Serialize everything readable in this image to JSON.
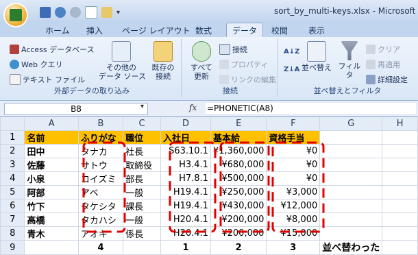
{
  "window": {
    "title": "sort_by_multi-keys.xlsx - Microsoft Exce"
  },
  "tabs": [
    "ホーム",
    "挿入",
    "ページ レイアウト",
    "数式",
    "データ",
    "校閲",
    "表示"
  ],
  "ribbon": {
    "external": {
      "access": "Access データベース",
      "web": "Web クエリ",
      "text": "テキスト ファイル",
      "other": "その他の\nデータ ソース",
      "existing": "既存の\n接続",
      "label": "外部データの取り込み"
    },
    "connections": {
      "refresh": "すべて\n更新",
      "conn": "接続",
      "props": "プロパティ",
      "links": "リンクの編集",
      "label": "接続"
    },
    "sortfilter": {
      "sort": "並べ替え",
      "filter": "フィルタ",
      "clear": "クリア",
      "reapply": "再適用",
      "advanced": "詳細設定",
      "label": "並べ替えとフィルタ"
    }
  },
  "formula_bar": {
    "name_box": "B8",
    "fx": "fx",
    "formula": "=PHONETIC(A8)"
  },
  "columns": [
    "A",
    "B",
    "C",
    "D",
    "E",
    "F",
    "G",
    "H"
  ],
  "rows": [
    {
      "n": "1",
      "cells": [
        "名前",
        "ふりがな",
        "職位",
        "入社日",
        "基本給",
        "資格手当",
        "",
        ""
      ]
    },
    {
      "n": "2",
      "cells": [
        "田中",
        "タナカ",
        "社長",
        "S63.10.1",
        "¥1,360,000",
        "¥0",
        "",
        ""
      ]
    },
    {
      "n": "3",
      "cells": [
        "佐藤",
        "サトウ",
        "取締役",
        "H3.4.1",
        "¥680,000",
        "¥0",
        "",
        ""
      ]
    },
    {
      "n": "4",
      "cells": [
        "小泉",
        "コイズミ",
        "部長",
        "H7.8.1",
        "¥500,000",
        "¥0",
        "",
        ""
      ]
    },
    {
      "n": "5",
      "cells": [
        "阿部",
        "アベ",
        "一般",
        "H19.4.1",
        "¥250,000",
        "¥3,000",
        "",
        ""
      ]
    },
    {
      "n": "6",
      "cells": [
        "竹下",
        "タケシタ",
        "課長",
        "H19.4.1",
        "¥430,000",
        "¥12,000",
        "",
        ""
      ]
    },
    {
      "n": "7",
      "cells": [
        "高橋",
        "タカハシ",
        "一般",
        "H20.4.1",
        "¥200,000",
        "¥8,000",
        "",
        ""
      ]
    },
    {
      "n": "8",
      "cells": [
        "青木",
        "アオキ",
        "係長",
        "H20.4.1",
        "¥200,000",
        "¥15,000",
        "",
        ""
      ]
    },
    {
      "n": "9",
      "cells": [
        "",
        "4",
        "",
        "1",
        "2",
        "3",
        "並べ替わった",
        ""
      ]
    }
  ]
}
